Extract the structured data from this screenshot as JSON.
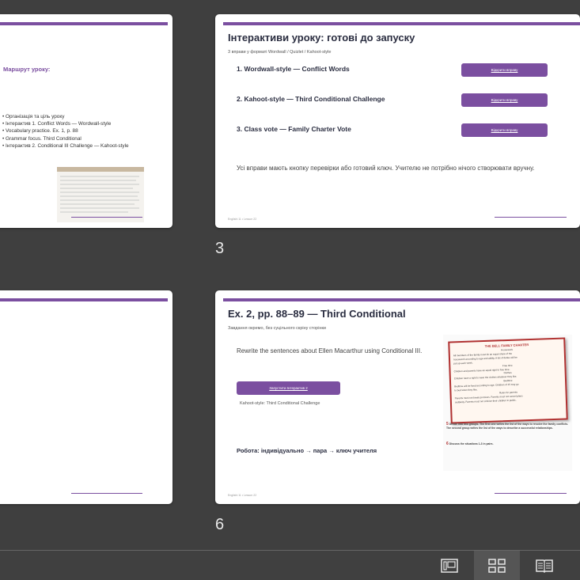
{
  "slide_left_top": {
    "heading": "Маршрут уроку:",
    "bullets": [
      "Організація та ціль уроку",
      "Інтерактив 1. Conflict Words — Wordwall-style",
      "Vocabulary practice. Ex. 1, p. 88",
      "Grammar focus. Third Conditional",
      "Інтерактив 2. Conditional III Challenge — Kahoot-style"
    ]
  },
  "slide3": {
    "number": "3",
    "title": "Інтерактиви уроку: готові до запуску",
    "subtitle": "3 вправи у форматі Wordwall / Quizlet / Kahoot-style",
    "items": [
      {
        "label": "1. Wordwall-style — Conflict Words",
        "button": "Відкрити вправу"
      },
      {
        "label": "2. Kahoot-style — Third Conditional Challenge",
        "button": "Відкрити вправу"
      },
      {
        "label": "3. Class vote — Family Charter Vote",
        "button": "Відкрити вправу"
      }
    ],
    "note": "Усі вправи мають кнопку перевірки або готовий ключ. Учителю не потрібно нічого створювати вручну.",
    "footer": "Englishi 11 • Lesson 22"
  },
  "slide6": {
    "number": "6",
    "title": "Ex. 2, pp. 88–89 — Third Conditional",
    "subtitle": "Завдання окремо, без суцільного скріну сторінки",
    "instruction": "Rewrite the sentences about Ellen Macarthur using Conditional III.",
    "button": "Запустити Інтерактив 2",
    "button_caption": "Kahoot-style: Third Conditional Challenge",
    "work_mode": "Робота: індивідуально → пара → ключ учителя",
    "footer": "Englishi 11 • Lesson 22",
    "charter": {
      "title": "THE BELL FAMILY CHARTER",
      "lines": [
        "Housework",
        "All members of the family must do an equal share of the",
        "housework according to age and ability. A list of duties will be",
        "put up each week.",
        "Free time",
        "Children and parents have an equal right to free time.",
        "Clothes",
        "Children have a right to wear the clothes whatever they like.",
        "Bedtime",
        "Bedtime will be fixed according to age. Children of 15 may go",
        "to bed when they like.",
        "Rules for parents",
        "Parents must not break promises. Parents must not cancel plans",
        "suddenly. Parents must not criticise their children in public."
      ]
    },
    "tasks": [
      {
        "num": "5",
        "text": "Divide into two groups. The first one writes the list of the ways to resolve the family conflicts. The second group writes the list of the ways to describe a successful relationships."
      },
      {
        "num": "6",
        "text": "Discuss the situations 1-3 in pairs."
      }
    ]
  },
  "toolbar": {
    "buttons": [
      {
        "name": "normal-view",
        "active": false
      },
      {
        "name": "slide-sorter",
        "active": true
      },
      {
        "name": "reading-view",
        "active": false
      }
    ]
  }
}
